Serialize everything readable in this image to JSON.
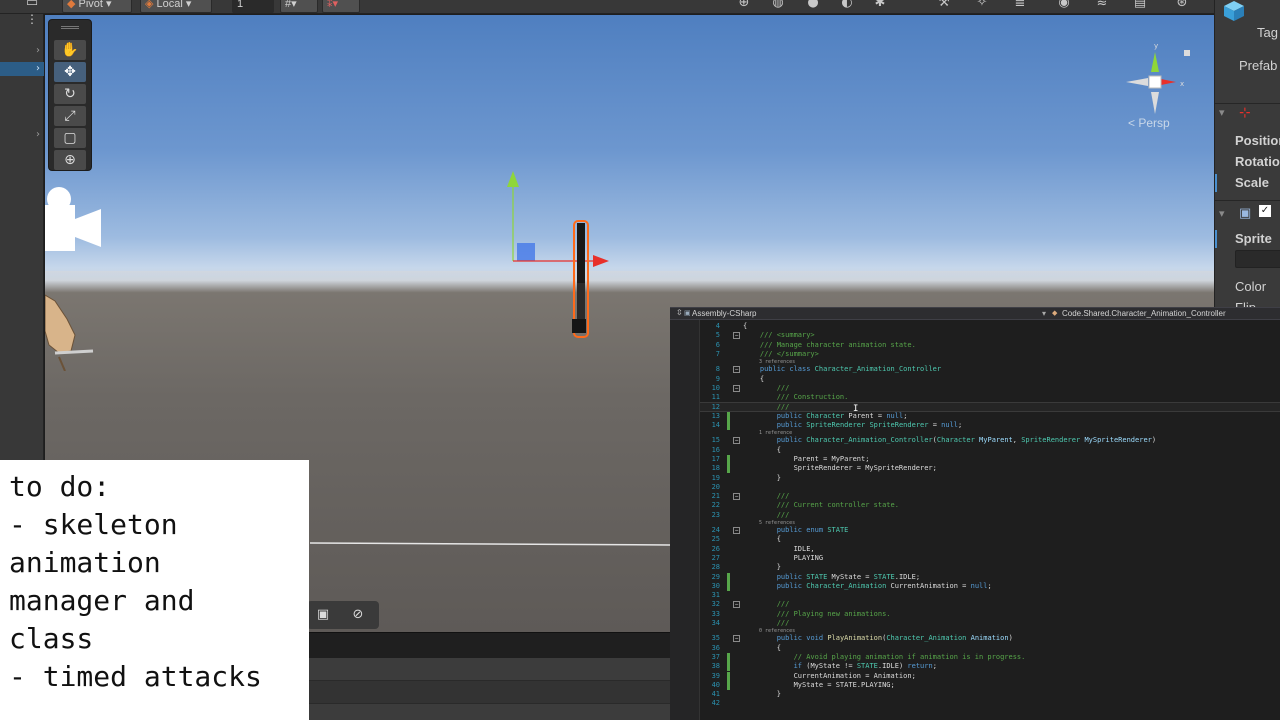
{
  "toolbar": {
    "pivot_label": "Pivot",
    "local_label": "Local",
    "grid_value": "1",
    "icons": [
      "layout-icon",
      "grid-snap-icon",
      "snap-settings-icon",
      "globe-icon",
      "sphere-icon",
      "circle-icon",
      "refresh-icon",
      "bug-icon",
      "tools-icon",
      "stars-icon",
      "audio-icon",
      "effects-icon",
      "visibility-icon",
      "layers-icon",
      "gizmo-icon"
    ]
  },
  "hierarchy": {
    "selected_row_color": "#2c5d87"
  },
  "scene": {
    "tools": [
      "hand-tool",
      "move-tool",
      "rotate-tool",
      "scale-tool",
      "rect-tool",
      "transform-tool"
    ],
    "active_tool": "move-tool",
    "persp_label": "< Persp"
  },
  "inspector": {
    "tag_label": "Tag",
    "prefab_label": "Prefab",
    "position_label": "Position",
    "rotation_label": "Rotation",
    "scale_label": "Scale",
    "sprite_label": "Sprite",
    "color_label": "Color",
    "flip_label": "Flip"
  },
  "notes": {
    "lines": [
      "to do:",
      "- skeleton",
      "animation",
      "manager and",
      "class",
      "- timed attacks"
    ]
  },
  "editor": {
    "project": "Assembly-CSharp",
    "class_path": "Code.Shared.Character_Animation_Controller",
    "lines": [
      {
        "n": "4",
        "t": "{",
        "c": "tx"
      },
      {
        "n": "5",
        "t": "    /// <summary>",
        "c": "cm",
        "fold": true
      },
      {
        "n": "6",
        "t": "    /// Manage character animation state.",
        "c": "cm"
      },
      {
        "n": "7",
        "t": "    /// </summary>",
        "c": "cm"
      },
      {
        "ref": "3 references"
      },
      {
        "n": "8",
        "t": "    public class Character_Animation_Controller",
        "c": "mix",
        "fold": true
      },
      {
        "n": "9",
        "t": "    {",
        "c": "tx"
      },
      {
        "n": "10",
        "t": "        ///",
        "c": "cm",
        "fold": true
      },
      {
        "n": "11",
        "t": "        /// Construction.",
        "c": "cm"
      },
      {
        "n": "12",
        "t": "        ///",
        "c": "cm",
        "cur": true
      },
      {
        "n": "13",
        "t": "        public Character Parent = null;",
        "c": "mix",
        "chg": true
      },
      {
        "n": "14",
        "t": "        public SpriteRenderer SpriteRenderer = null;",
        "c": "mix",
        "chg": true
      },
      {
        "ref": "1 reference"
      },
      {
        "n": "15",
        "t": "        public Character_Animation_Controller(Character MyParent, SpriteRenderer MySpriteRenderer)",
        "c": "mix",
        "fold": true
      },
      {
        "n": "16",
        "t": "        {",
        "c": "tx"
      },
      {
        "n": "17",
        "t": "            Parent = MyParent;",
        "c": "tx",
        "chg": true
      },
      {
        "n": "18",
        "t": "            SpriteRenderer = MySpriteRenderer;",
        "c": "tx",
        "chg": true
      },
      {
        "n": "19",
        "t": "        }",
        "c": "tx"
      },
      {
        "n": "20",
        "t": "",
        "c": "tx"
      },
      {
        "n": "21",
        "t": "        ///",
        "c": "cm",
        "fold": true
      },
      {
        "n": "22",
        "t": "        /// Current controller state.",
        "c": "cm"
      },
      {
        "n": "23",
        "t": "        ///",
        "c": "cm"
      },
      {
        "ref": "5 references"
      },
      {
        "n": "24",
        "t": "        public enum STATE",
        "c": "mix",
        "fold": true
      },
      {
        "n": "25",
        "t": "        {",
        "c": "tx"
      },
      {
        "n": "26",
        "t": "            IDLE,",
        "c": "tx"
      },
      {
        "n": "27",
        "t": "            PLAYING",
        "c": "tx"
      },
      {
        "n": "28",
        "t": "        }",
        "c": "tx"
      },
      {
        "n": "29",
        "t": "        public STATE MyState = STATE.IDLE;",
        "c": "mix",
        "chg": true
      },
      {
        "n": "30",
        "t": "        public Character_Animation CurrentAnimation = null;",
        "c": "mix",
        "chg": true
      },
      {
        "n": "31",
        "t": "",
        "c": "tx"
      },
      {
        "n": "32",
        "t": "        ///",
        "c": "cm",
        "fold": true
      },
      {
        "n": "33",
        "t": "        /// Playing new animations.",
        "c": "cm"
      },
      {
        "n": "34",
        "t": "        ///",
        "c": "cm"
      },
      {
        "ref": "0 references"
      },
      {
        "n": "35",
        "t": "        public void PlayAnimation(Character_Animation Animation)",
        "c": "mix",
        "fold": true
      },
      {
        "n": "36",
        "t": "        {",
        "c": "tx"
      },
      {
        "n": "37",
        "t": "            // Avoid playing animation if animation is in progress.",
        "c": "cm",
        "chg": true
      },
      {
        "n": "38",
        "t": "            if (MyState != STATE.IDLE) return;",
        "c": "mix",
        "chg": true
      },
      {
        "n": "39",
        "t": "            CurrentAnimation = Animation;",
        "c": "tx",
        "chg": true
      },
      {
        "n": "40",
        "t": "            MyState = STATE.PLAYING;",
        "c": "tx",
        "chg": true
      },
      {
        "n": "41",
        "t": "        }",
        "c": "tx"
      },
      {
        "n": "42",
        "t": "",
        "c": "tx"
      }
    ]
  },
  "colors": {
    "keyword": "#569cd6",
    "type": "#4ec9b0",
    "comment": "#57a64a",
    "line_number": "#2b91af",
    "gizmo_x": "#e8302a",
    "gizmo_y": "#8fd63a",
    "gizmo_z": "#4a7de8"
  }
}
